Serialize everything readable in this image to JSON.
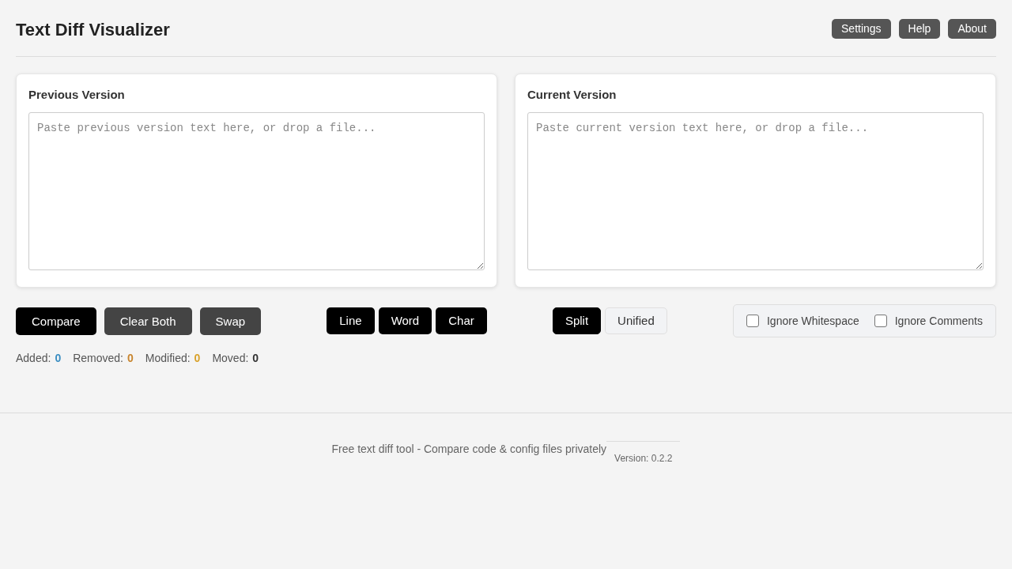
{
  "header": {
    "title": "Text Diff Visualizer",
    "buttons": [
      "Settings",
      "Help",
      "About"
    ]
  },
  "panels": [
    {
      "title": "Previous Version",
      "placeholder": "Paste previous version text here, or drop a file..."
    },
    {
      "title": "Current Version",
      "placeholder": "Paste current version text here, or drop a file..."
    }
  ],
  "actions": [
    {
      "label": "Compare",
      "kind": "primary"
    },
    {
      "label": "Clear Both",
      "kind": "secondary"
    },
    {
      "label": "Swap",
      "kind": "secondary"
    }
  ],
  "granularity": [
    "Line",
    "Word",
    "Char"
  ],
  "view_modes": [
    {
      "label": "Split",
      "selected": true
    },
    {
      "label": "Unified",
      "selected": false
    }
  ],
  "options": [
    {
      "label": "Ignore Whitespace",
      "checked": false
    },
    {
      "label": "Ignore Comments",
      "checked": false
    }
  ],
  "stats": [
    {
      "label": "Added:",
      "value": "0",
      "color": "#3b8ec2"
    },
    {
      "label": "Removed:",
      "value": "0",
      "color": "#c8852e"
    },
    {
      "label": "Modified:",
      "value": "0",
      "color": "#d9a22b"
    },
    {
      "label": "Moved:",
      "value": "0",
      "color": "#333333"
    }
  ],
  "footer": {
    "text": "Free text diff tool - Compare code & config files privately",
    "version": "Version: 0.2.2"
  }
}
